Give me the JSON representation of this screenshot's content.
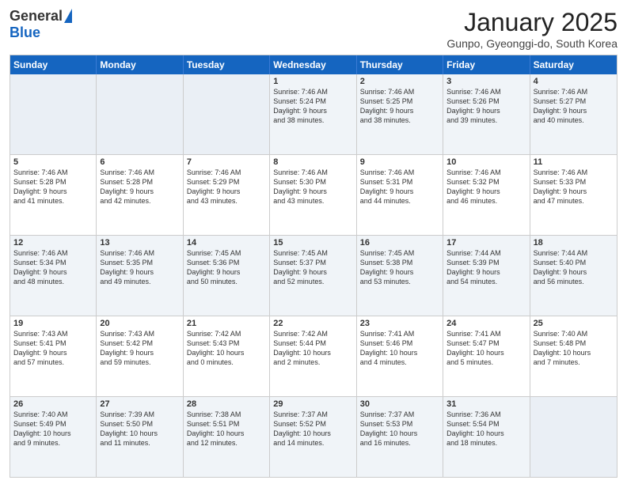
{
  "header": {
    "logo_general": "General",
    "logo_blue": "Blue",
    "month_title": "January 2025",
    "location": "Gunpo, Gyeonggi-do, South Korea"
  },
  "day_headers": [
    "Sunday",
    "Monday",
    "Tuesday",
    "Wednesday",
    "Thursday",
    "Friday",
    "Saturday"
  ],
  "weeks": [
    [
      {
        "day": "",
        "info": "",
        "empty": true
      },
      {
        "day": "",
        "info": "",
        "empty": true
      },
      {
        "day": "",
        "info": "",
        "empty": true
      },
      {
        "day": "1",
        "info": "Sunrise: 7:46 AM\nSunset: 5:24 PM\nDaylight: 9 hours\nand 38 minutes.",
        "empty": false
      },
      {
        "day": "2",
        "info": "Sunrise: 7:46 AM\nSunset: 5:25 PM\nDaylight: 9 hours\nand 38 minutes.",
        "empty": false
      },
      {
        "day": "3",
        "info": "Sunrise: 7:46 AM\nSunset: 5:26 PM\nDaylight: 9 hours\nand 39 minutes.",
        "empty": false
      },
      {
        "day": "4",
        "info": "Sunrise: 7:46 AM\nSunset: 5:27 PM\nDaylight: 9 hours\nand 40 minutes.",
        "empty": false
      }
    ],
    [
      {
        "day": "5",
        "info": "Sunrise: 7:46 AM\nSunset: 5:28 PM\nDaylight: 9 hours\nand 41 minutes.",
        "empty": false
      },
      {
        "day": "6",
        "info": "Sunrise: 7:46 AM\nSunset: 5:28 PM\nDaylight: 9 hours\nand 42 minutes.",
        "empty": false
      },
      {
        "day": "7",
        "info": "Sunrise: 7:46 AM\nSunset: 5:29 PM\nDaylight: 9 hours\nand 43 minutes.",
        "empty": false
      },
      {
        "day": "8",
        "info": "Sunrise: 7:46 AM\nSunset: 5:30 PM\nDaylight: 9 hours\nand 43 minutes.",
        "empty": false
      },
      {
        "day": "9",
        "info": "Sunrise: 7:46 AM\nSunset: 5:31 PM\nDaylight: 9 hours\nand 44 minutes.",
        "empty": false
      },
      {
        "day": "10",
        "info": "Sunrise: 7:46 AM\nSunset: 5:32 PM\nDaylight: 9 hours\nand 46 minutes.",
        "empty": false
      },
      {
        "day": "11",
        "info": "Sunrise: 7:46 AM\nSunset: 5:33 PM\nDaylight: 9 hours\nand 47 minutes.",
        "empty": false
      }
    ],
    [
      {
        "day": "12",
        "info": "Sunrise: 7:46 AM\nSunset: 5:34 PM\nDaylight: 9 hours\nand 48 minutes.",
        "empty": false
      },
      {
        "day": "13",
        "info": "Sunrise: 7:46 AM\nSunset: 5:35 PM\nDaylight: 9 hours\nand 49 minutes.",
        "empty": false
      },
      {
        "day": "14",
        "info": "Sunrise: 7:45 AM\nSunset: 5:36 PM\nDaylight: 9 hours\nand 50 minutes.",
        "empty": false
      },
      {
        "day": "15",
        "info": "Sunrise: 7:45 AM\nSunset: 5:37 PM\nDaylight: 9 hours\nand 52 minutes.",
        "empty": false
      },
      {
        "day": "16",
        "info": "Sunrise: 7:45 AM\nSunset: 5:38 PM\nDaylight: 9 hours\nand 53 minutes.",
        "empty": false
      },
      {
        "day": "17",
        "info": "Sunrise: 7:44 AM\nSunset: 5:39 PM\nDaylight: 9 hours\nand 54 minutes.",
        "empty": false
      },
      {
        "day": "18",
        "info": "Sunrise: 7:44 AM\nSunset: 5:40 PM\nDaylight: 9 hours\nand 56 minutes.",
        "empty": false
      }
    ],
    [
      {
        "day": "19",
        "info": "Sunrise: 7:43 AM\nSunset: 5:41 PM\nDaylight: 9 hours\nand 57 minutes.",
        "empty": false
      },
      {
        "day": "20",
        "info": "Sunrise: 7:43 AM\nSunset: 5:42 PM\nDaylight: 9 hours\nand 59 minutes.",
        "empty": false
      },
      {
        "day": "21",
        "info": "Sunrise: 7:42 AM\nSunset: 5:43 PM\nDaylight: 10 hours\nand 0 minutes.",
        "empty": false
      },
      {
        "day": "22",
        "info": "Sunrise: 7:42 AM\nSunset: 5:44 PM\nDaylight: 10 hours\nand 2 minutes.",
        "empty": false
      },
      {
        "day": "23",
        "info": "Sunrise: 7:41 AM\nSunset: 5:46 PM\nDaylight: 10 hours\nand 4 minutes.",
        "empty": false
      },
      {
        "day": "24",
        "info": "Sunrise: 7:41 AM\nSunset: 5:47 PM\nDaylight: 10 hours\nand 5 minutes.",
        "empty": false
      },
      {
        "day": "25",
        "info": "Sunrise: 7:40 AM\nSunset: 5:48 PM\nDaylight: 10 hours\nand 7 minutes.",
        "empty": false
      }
    ],
    [
      {
        "day": "26",
        "info": "Sunrise: 7:40 AM\nSunset: 5:49 PM\nDaylight: 10 hours\nand 9 minutes.",
        "empty": false
      },
      {
        "day": "27",
        "info": "Sunrise: 7:39 AM\nSunset: 5:50 PM\nDaylight: 10 hours\nand 11 minutes.",
        "empty": false
      },
      {
        "day": "28",
        "info": "Sunrise: 7:38 AM\nSunset: 5:51 PM\nDaylight: 10 hours\nand 12 minutes.",
        "empty": false
      },
      {
        "day": "29",
        "info": "Sunrise: 7:37 AM\nSunset: 5:52 PM\nDaylight: 10 hours\nand 14 minutes.",
        "empty": false
      },
      {
        "day": "30",
        "info": "Sunrise: 7:37 AM\nSunset: 5:53 PM\nDaylight: 10 hours\nand 16 minutes.",
        "empty": false
      },
      {
        "day": "31",
        "info": "Sunrise: 7:36 AM\nSunset: 5:54 PM\nDaylight: 10 hours\nand 18 minutes.",
        "empty": false
      },
      {
        "day": "",
        "info": "",
        "empty": true
      }
    ]
  ],
  "alt_rows": [
    0,
    2,
    4
  ]
}
